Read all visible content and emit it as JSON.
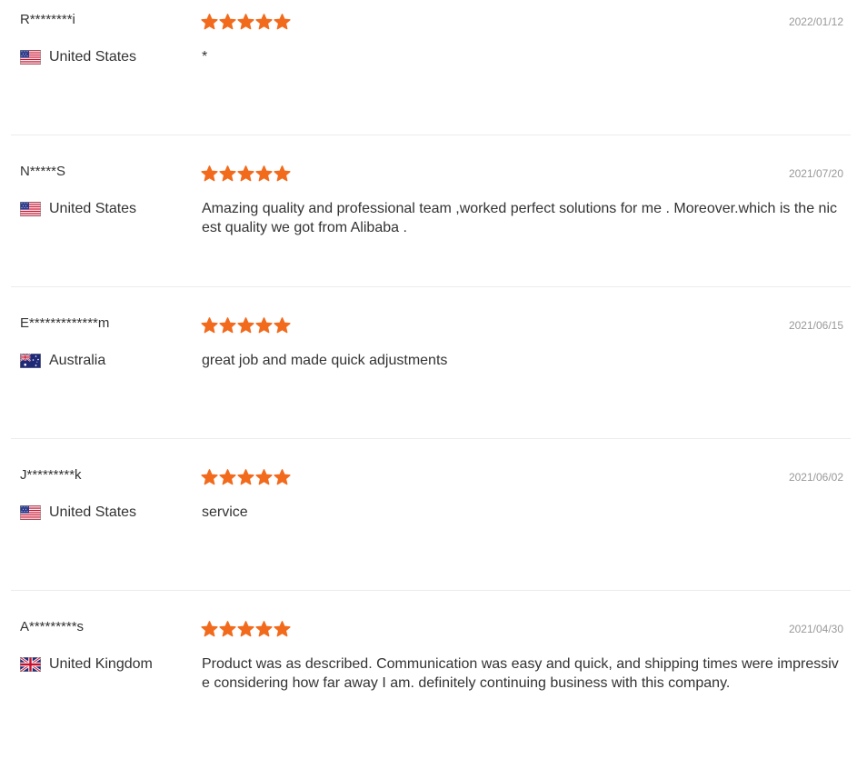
{
  "colors": {
    "star": "#f26b1d",
    "date": "#999999",
    "text": "#333333",
    "divider": "#ececec"
  },
  "reviews": [
    {
      "name": "R********i",
      "country": "United States",
      "flag": "us-flag-icon",
      "rating": 5,
      "date": "2022/01/12",
      "text": "*"
    },
    {
      "name": "N*****S",
      "country": "United States",
      "flag": "us-flag-icon",
      "rating": 5,
      "date": "2021/07/20",
      "text": "Amazing quality and professional team ,worked perfect solutions for me . Moreover.which is the nicest quality we got from Alibaba ."
    },
    {
      "name": "E*************m",
      "country": "Australia",
      "flag": "au-flag-icon",
      "rating": 5,
      "date": "2021/06/15",
      "text": "great job and made quick adjustments"
    },
    {
      "name": "J*********k",
      "country": "United States",
      "flag": "us-flag-icon",
      "rating": 5,
      "date": "2021/06/02",
      "text": "service"
    },
    {
      "name": "A*********s",
      "country": "United Kingdom",
      "flag": "uk-flag-icon",
      "rating": 5,
      "date": "2021/04/30",
      "text": "Product was as described. Communication was easy and quick, and shipping times were impressive considering how far away I am. definitely continuing business with this company."
    }
  ]
}
